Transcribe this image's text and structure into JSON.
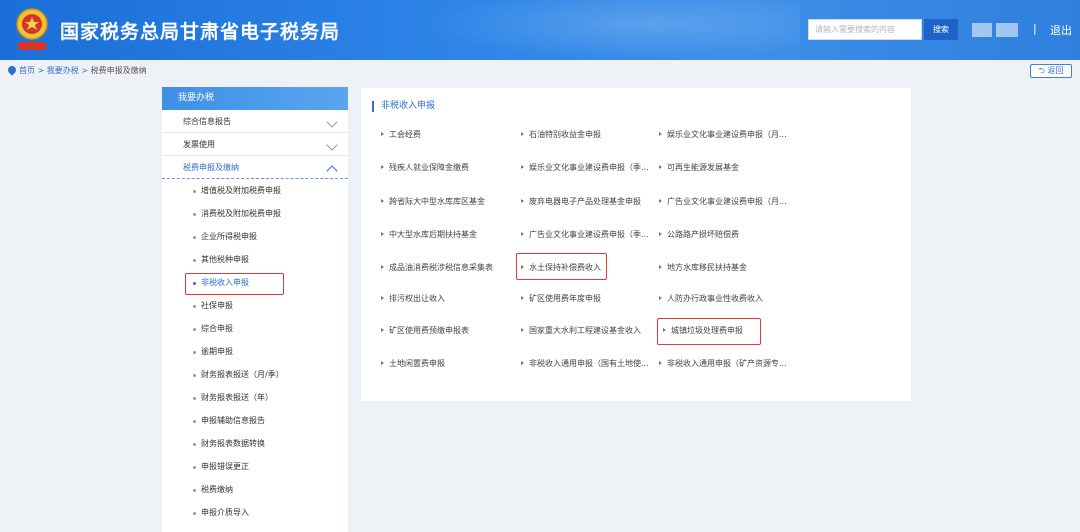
{
  "header": {
    "title": "国家税务总局甘肃省电子税务局",
    "search_placeholder": "请输入需要搜索的内容",
    "search_button": "搜索",
    "separator": "|",
    "logout": "退出"
  },
  "breadcrumb": {
    "home": "首页",
    "sep1": " > ",
    "level2": "我要办税",
    "sep2": " > ",
    "current": "税费申报及缴纳"
  },
  "back_button": "返回",
  "sidebar": {
    "title": "我要办税",
    "groups": [
      {
        "label": "综合信息报告"
      },
      {
        "label": "发票使用"
      },
      {
        "label": "税费申报及缴纳"
      }
    ],
    "sub_items": [
      {
        "label": "增值税及附加税费申报"
      },
      {
        "label": "消费税及附加税费申报"
      },
      {
        "label": "企业所得税申报"
      },
      {
        "label": "其他税种申报"
      },
      {
        "label": "非税收入申报"
      },
      {
        "label": "社保申报"
      },
      {
        "label": "综合申报"
      },
      {
        "label": "逾期申报"
      },
      {
        "label": "财务报表报送（月/季）"
      },
      {
        "label": "财务报表报送（年）"
      },
      {
        "label": "申报辅助信息报告"
      },
      {
        "label": "财务报表数据转换"
      },
      {
        "label": "申报错误更正"
      },
      {
        "label": "税费缴纳"
      },
      {
        "label": "申报介质导入"
      }
    ]
  },
  "main": {
    "title": "非税收入申报",
    "items": [
      {
        "label": "工会经费"
      },
      {
        "label": "石油特别收益金申报"
      },
      {
        "label": "娱乐业文化事业建设费申报（月..."
      },
      {
        "label": "残疾人就业保障金缴费"
      },
      {
        "label": "娱乐业文化事业建设费申报（季..."
      },
      {
        "label": "可再生能源发展基金"
      },
      {
        "label": "跨省际大中型水库库区基金"
      },
      {
        "label": "废弃电器电子产品处理基金申报"
      },
      {
        "label": "广告业文化事业建设费申报（月..."
      },
      {
        "label": "中大型水库后期扶持基金"
      },
      {
        "label": "广告业文化事业建设费申报（季..."
      },
      {
        "label": "公路路产损坏赔偿费"
      },
      {
        "label": "成品油消费税涉税信息采集表"
      },
      {
        "label": "水土保持补偿费收入"
      },
      {
        "label": "地方水库移民扶持基金"
      },
      {
        "label": "排污权出让收入"
      },
      {
        "label": "矿区使用费年度申报"
      },
      {
        "label": "人防办行政事业性收费收入"
      },
      {
        "label": "矿区使用费预缴申报表"
      },
      {
        "label": "国家重大水利工程建设基金收入"
      },
      {
        "label": "城镇垃圾处理费申报"
      },
      {
        "label": "土地闲置费申报"
      },
      {
        "label": "非税收入通用申报（国有土地使..."
      },
      {
        "label": "非税收入通用申报（矿产资源专..."
      }
    ]
  },
  "colors": {
    "header_blue": "#2f86e8",
    "link_blue": "#2f6fd0",
    "highlight_red": "#e03a3a"
  }
}
